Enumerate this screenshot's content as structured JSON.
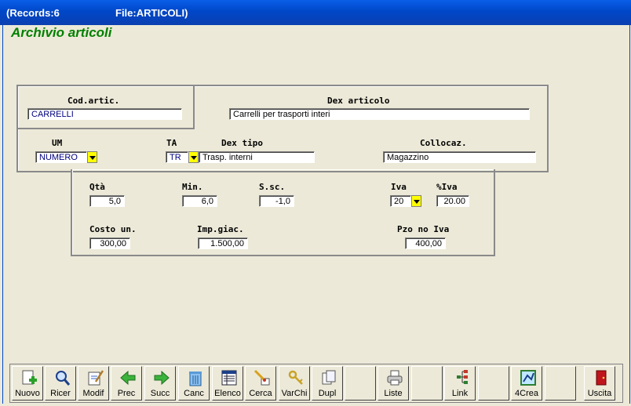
{
  "window": {
    "records": "(Records:6",
    "file": "File:ARTICOLI)"
  },
  "app_title": "Archivio articoli",
  "labels": {
    "cod": "Cod.artic.",
    "dex": "Dex articolo",
    "um": "UM",
    "ta": "TA",
    "dextipo": "Dex tipo",
    "collocaz": "Collocaz.",
    "qta": "Qtà",
    "min": "Min.",
    "ssc": "S.sc.",
    "iva": "Iva",
    "piva": "%Iva",
    "costo": "Costo un.",
    "impgiac": "Imp.giac.",
    "pzo": "Pzo no Iva"
  },
  "values": {
    "cod": "CARRELLI",
    "dex": "Carrelli per trasporti interi",
    "um": "NUMERO",
    "ta": "TR",
    "dextipo": "Trasp. interni",
    "collocaz": "Magazzino",
    "qta": "5,0",
    "min": "6,0",
    "ssc": "-1,0",
    "iva": "20",
    "piva": "20.00",
    "costo": "300,00",
    "impgiac": "1.500,00",
    "pzo": "400,00"
  },
  "toolbar": [
    {
      "label": "Nuovo",
      "icon": "new-document-icon"
    },
    {
      "label": "Ricer",
      "icon": "search-icon"
    },
    {
      "label": "Modif",
      "icon": "edit-icon"
    },
    {
      "label": "Prec",
      "icon": "arrow-left-icon"
    },
    {
      "label": "Succ",
      "icon": "arrow-right-icon"
    },
    {
      "label": "Canc",
      "icon": "trash-icon"
    },
    {
      "label": "Elenco",
      "icon": "list-icon"
    },
    {
      "label": "Cerca",
      "icon": "find-icon"
    },
    {
      "label": "VarChi",
      "icon": "keys-icon"
    },
    {
      "label": "Dupl",
      "icon": "duplicate-icon"
    },
    {
      "label": "",
      "icon": ""
    },
    {
      "label": "Liste",
      "icon": "printer-icon"
    },
    {
      "label": "",
      "icon": ""
    },
    {
      "label": "Link",
      "icon": "link-tree-icon"
    },
    {
      "label": "",
      "icon": ""
    },
    {
      "label": "4Crea",
      "icon": "create-icon"
    },
    {
      "label": "",
      "icon": ""
    },
    {
      "label": "Uscita",
      "icon": "exit-door-icon"
    }
  ]
}
